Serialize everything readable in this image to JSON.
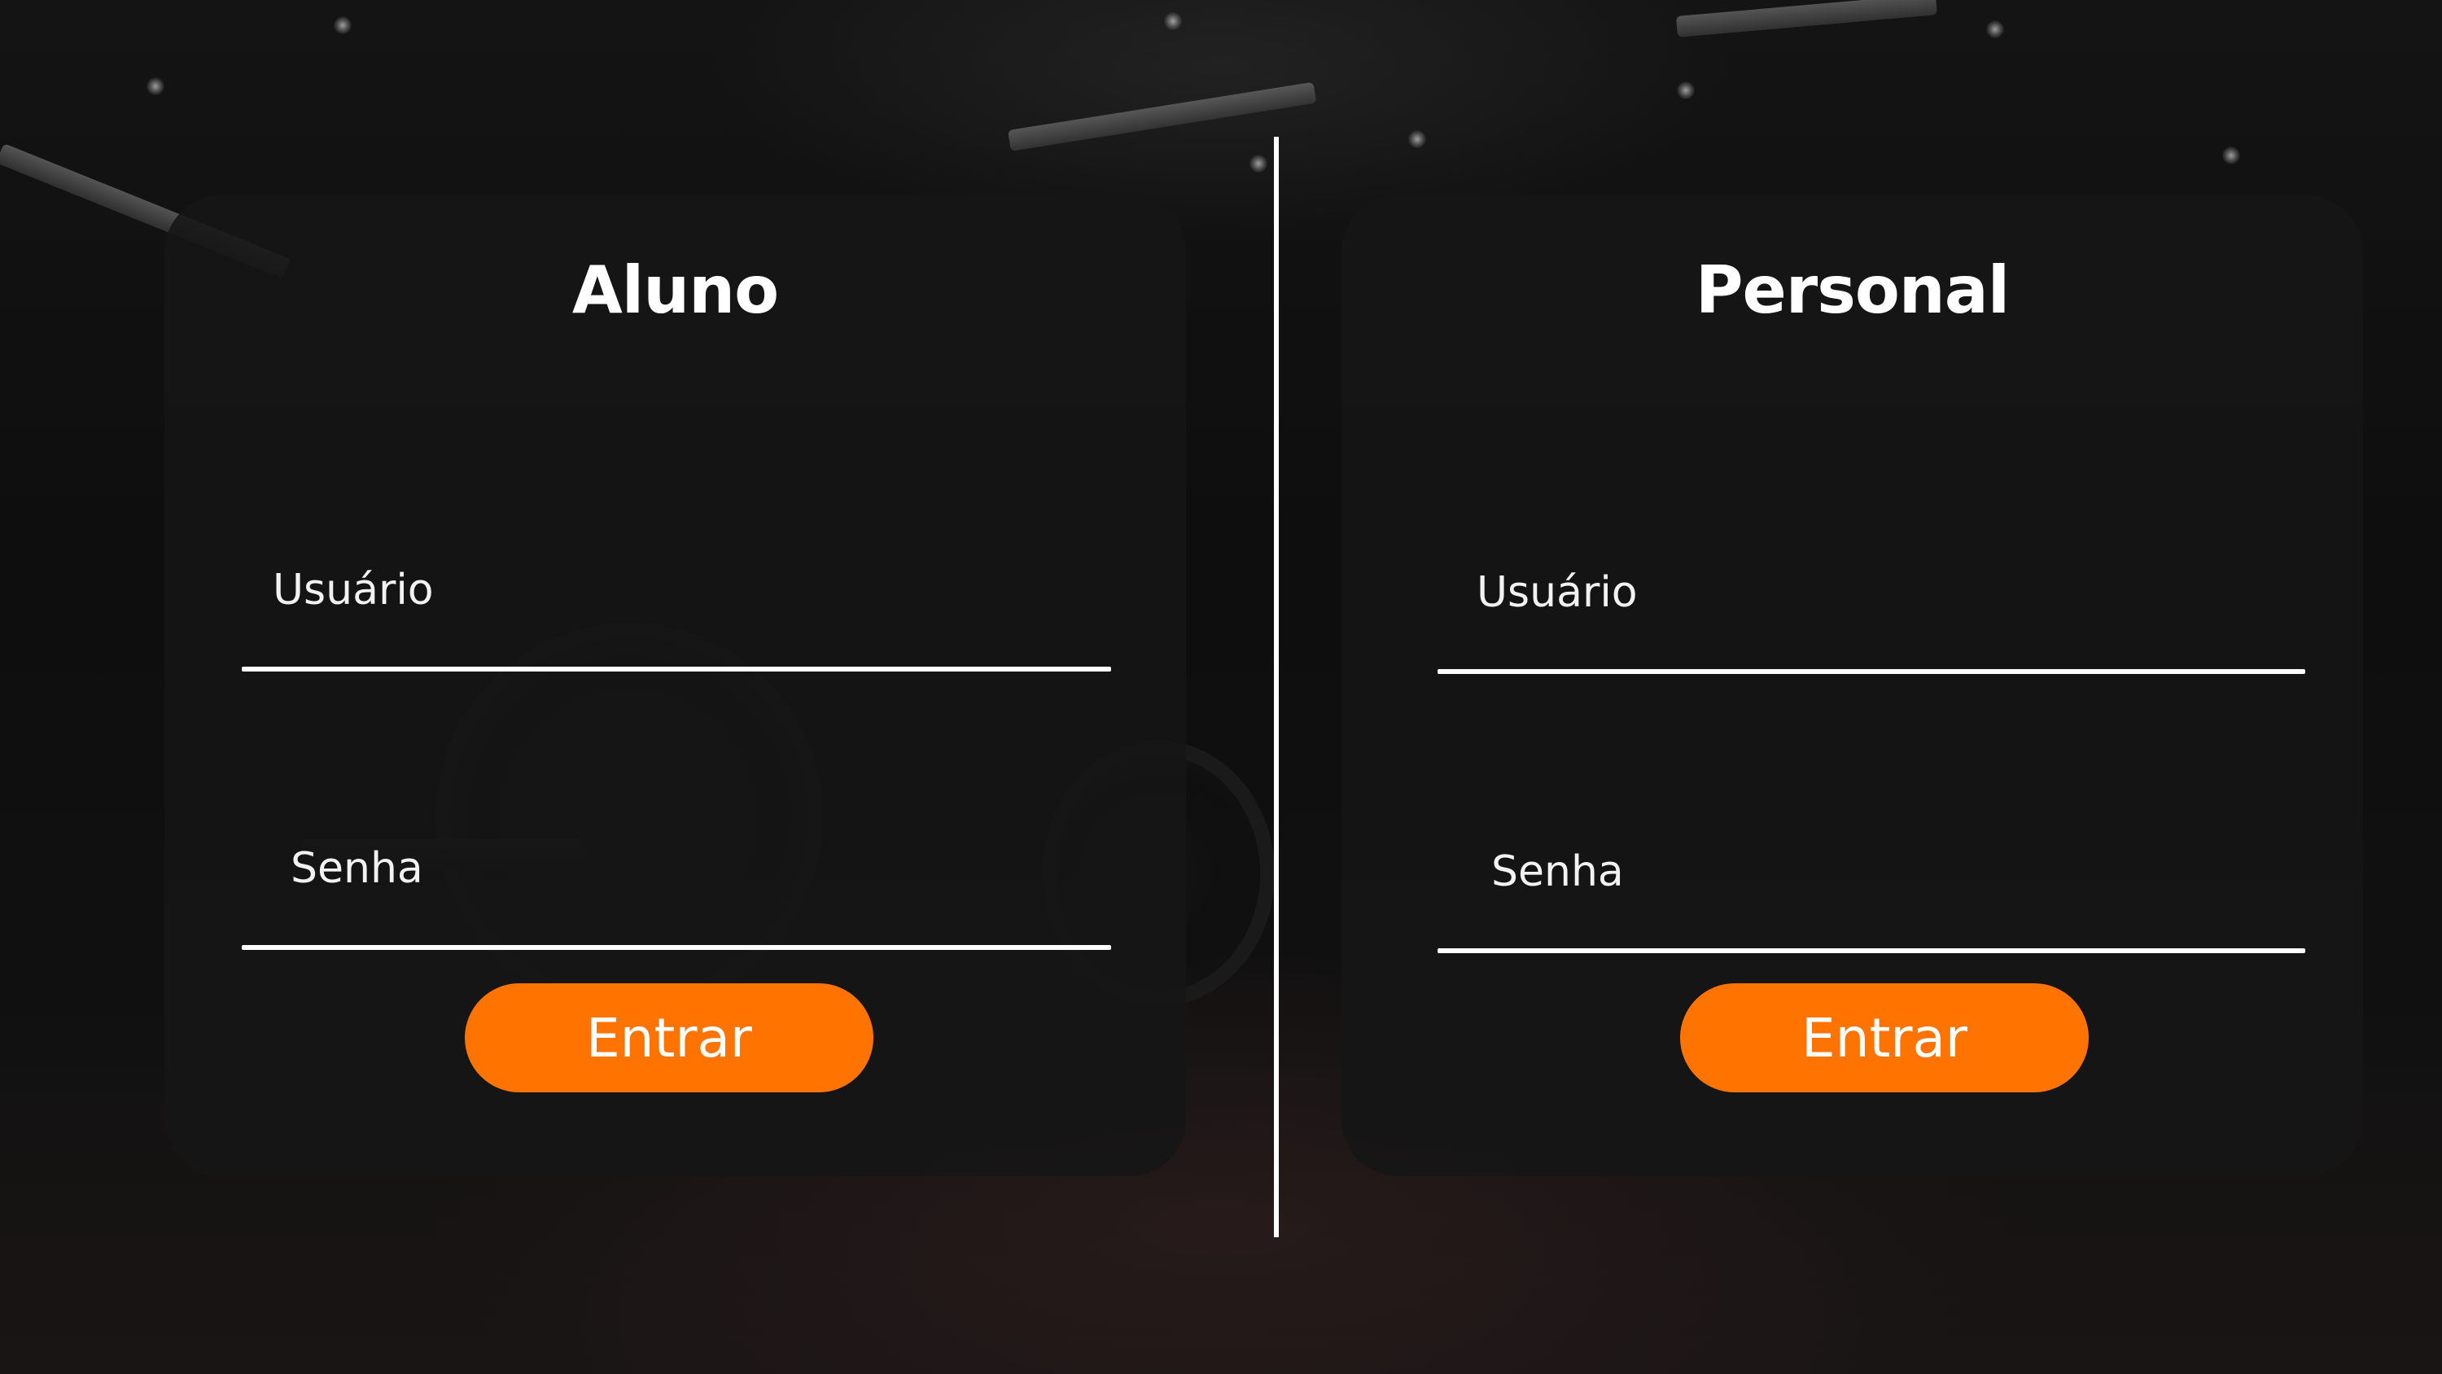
{
  "colors": {
    "accent": "#ff7300",
    "card": "#161616",
    "text": "#ffffff",
    "divider": "#ffffff"
  },
  "aluno": {
    "title": "Aluno",
    "username_label": "Usuário",
    "password_label": "Senha",
    "submit_label": "Entrar"
  },
  "personal": {
    "title": "Personal",
    "username_label": "Usuário",
    "password_label": "Senha",
    "submit_label": "Entrar"
  }
}
